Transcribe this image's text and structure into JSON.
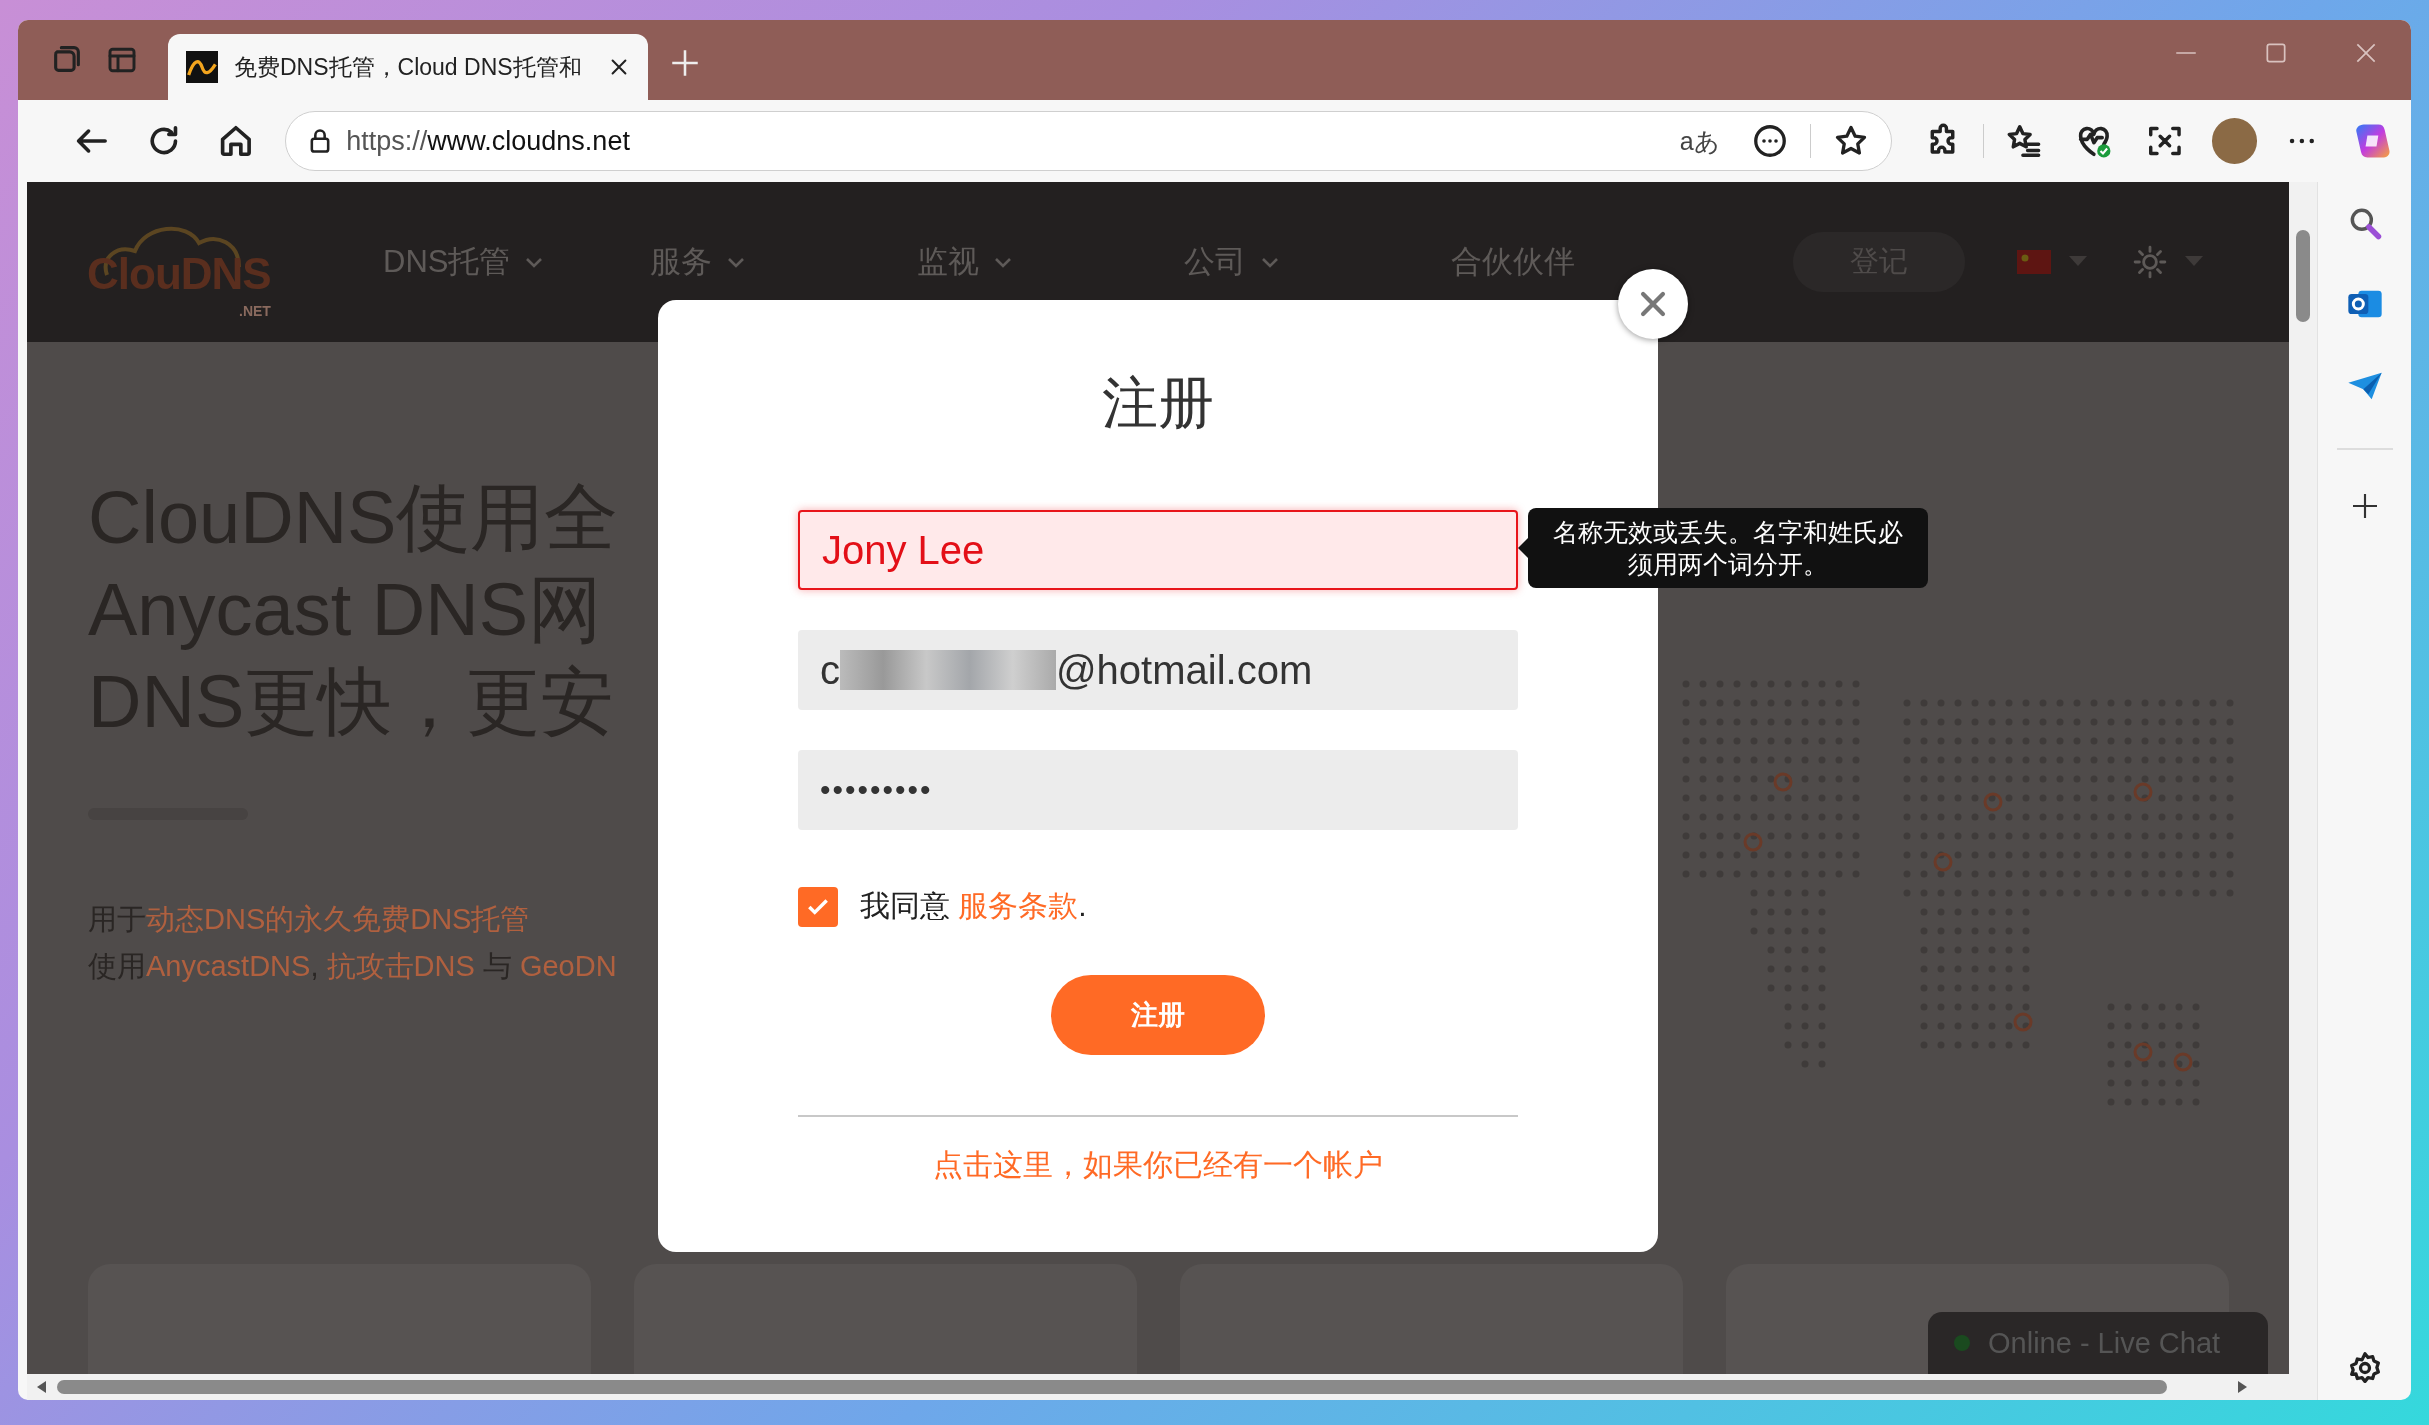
{
  "browser": {
    "tab": {
      "title": "免费DNS托管，Cloud DNS托管和",
      "selected": true
    },
    "address": {
      "scheme": "https://",
      "host": "www.cloudns.net"
    },
    "translate_label": "aあ"
  },
  "site": {
    "nav": [
      {
        "label": "DNS托管",
        "dropdown": true
      },
      {
        "label": "服务",
        "dropdown": true
      },
      {
        "label": "监视",
        "dropdown": true
      },
      {
        "label": "公司",
        "dropdown": true
      },
      {
        "label": "合伙伙伴",
        "dropdown": false
      }
    ],
    "logo": {
      "text": "ClouDNS",
      "suffix": ".NET"
    },
    "login": "登记",
    "hero": {
      "heading_lines": [
        "ClouDNS使用全",
        "Anycast DNS网",
        "DNS更快，更安"
      ],
      "lines": [
        [
          {
            "text": "用于",
            "link": false
          },
          {
            "text": "动态DNS的永久免费DNS托管",
            "link": true
          }
        ],
        [
          {
            "text": "使用",
            "link": false
          },
          {
            "text": "AnycastDNS",
            "link": true
          },
          {
            "text": ", ",
            "link": false
          },
          {
            "text": "抗攻击DNS",
            "link": true
          },
          {
            "text": " 与 ",
            "link": false
          },
          {
            "text": "GeoDN",
            "link": true
          }
        ]
      ]
    },
    "chat": {
      "label": "Online - Live Chat",
      "online": true
    }
  },
  "modal": {
    "title": "注册",
    "name_field": {
      "value": "Jony Lee",
      "invalid": true
    },
    "email_field": {
      "value_start": "c",
      "value_end": "@hotmail.com"
    },
    "password_field": {
      "value": "•••••••••"
    },
    "agree": {
      "checked": true,
      "parts": [
        {
          "text": "我同意 ",
          "link": false
        },
        {
          "text": "服务条款",
          "link": true
        },
        {
          "text": ".",
          "link": false
        }
      ]
    },
    "submit": "注册",
    "login_link": "点击这里，如果你已经有一个帐户",
    "tooltip": "名称无效或丢失。名字和姓氏必须用两个词分开。"
  }
}
